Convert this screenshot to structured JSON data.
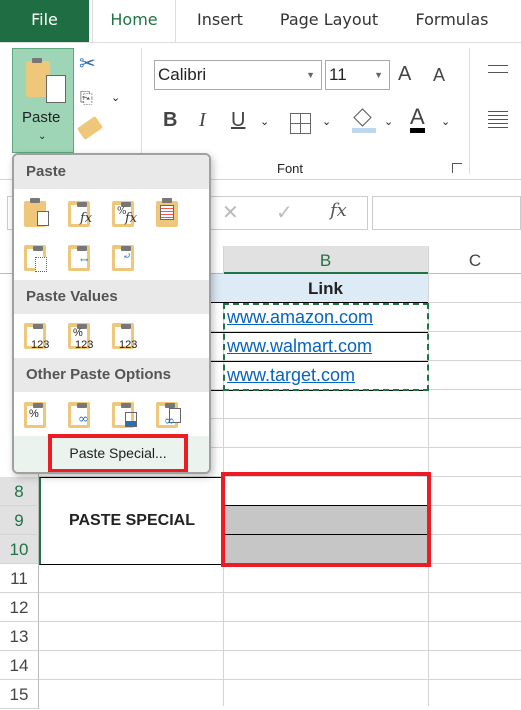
{
  "tabs": [
    {
      "label": "File"
    },
    {
      "label": "Home"
    },
    {
      "label": "Insert"
    },
    {
      "label": "Page Layout"
    },
    {
      "label": "Formulas"
    }
  ],
  "ribbon": {
    "paste_label": "Paste",
    "font_name": "Calibri",
    "font_size": "11",
    "font_group_label": "Font",
    "bold": "B",
    "italic": "I",
    "underline": "U",
    "grow_font": "A",
    "shrink_font": "A",
    "font_color": "A"
  },
  "formula_bar": {
    "cancel": "✕",
    "enter": "✓",
    "fx": "fx"
  },
  "columns": [
    "B",
    "C"
  ],
  "rows": [
    "8",
    "9",
    "10",
    "11",
    "12",
    "13",
    "14",
    "15"
  ],
  "cells": {
    "B1": "Link",
    "B2": "www.amazon.com",
    "B3": "www.walmart.com",
    "B4": "www.target.com",
    "A8": "PASTE SPECIAL"
  },
  "paste_menu": {
    "section_paste": "Paste",
    "section_values": "Paste Values",
    "section_other": "Other Paste Options",
    "paste_special": "Paste Special...",
    "paste_icons": [
      "paste-icon",
      "formulas-icon",
      "formulas-number-format-icon",
      "keep-source-formatting-icon",
      "no-borders-icon",
      "keep-column-widths-icon",
      "transpose-icon"
    ],
    "values_icons": [
      "values-icon",
      "values-number-format-icon",
      "values-source-formatting-icon"
    ],
    "other_icons": [
      "formatting-icon",
      "paste-link-icon",
      "picture-icon",
      "linked-picture-icon"
    ],
    "value_glyph": "123",
    "percent_glyph": "%"
  },
  "colors": {
    "accent": "#217346",
    "file_tab": "#1f6e43",
    "highlight": "#ed1c24",
    "hyperlink": "#0563c1",
    "header_fill": "#ddebf7",
    "gray_fill": "#c6c6c6"
  }
}
